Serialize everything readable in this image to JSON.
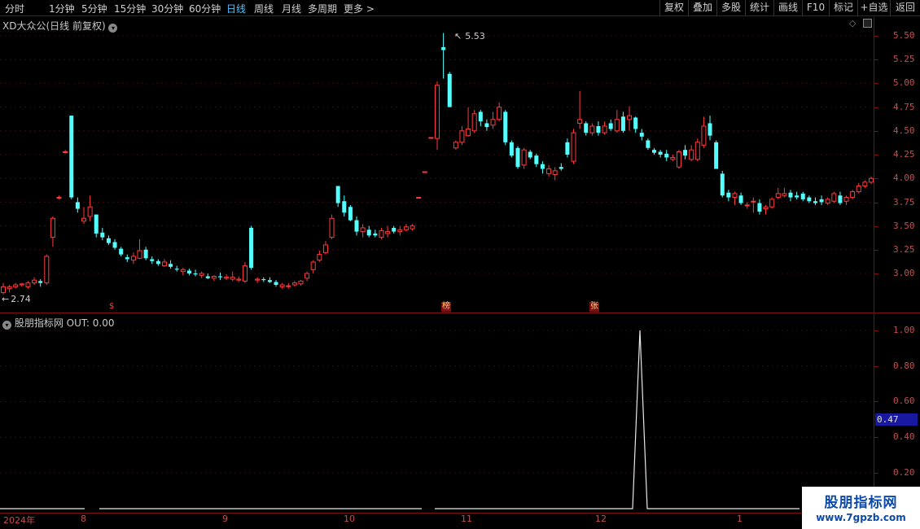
{
  "toolbar": {
    "periods": [
      "分时",
      "1分钟",
      "5分钟",
      "15分钟",
      "30分钟",
      "60分钟",
      "日线",
      "周线",
      "月线",
      "多周期",
      "更多 >"
    ],
    "active_period": "日线",
    "right_buttons": [
      "复权",
      "叠加",
      "多股",
      "统计",
      "画线",
      "F10",
      "标记",
      "+自选",
      "返回"
    ]
  },
  "main_panel": {
    "title": "XD大众公(日线 前复权)",
    "high_label": "5.53",
    "low_label": "2.74",
    "y_labels": [
      "5.50",
      "5.25",
      "5.00",
      "4.75",
      "4.50",
      "4.25",
      "4.00",
      "3.75",
      "3.50",
      "3.25",
      "3.00"
    ],
    "markers": [
      "$",
      "榜",
      "张"
    ]
  },
  "indicator_panel": {
    "title": "股朋指标网 OUT: 0.00",
    "y_labels": [
      "1.00",
      "0.80",
      "0.60",
      "0.40",
      "0.20"
    ],
    "current_value": "0.47"
  },
  "date_axis": [
    "2024年",
    "8",
    "9",
    "10",
    "11",
    "12",
    "1"
  ],
  "watermark": {
    "line1": "股朋指标网",
    "line2": "www.7gpzb.com"
  },
  "colors": {
    "up": "#ff3b3b",
    "down": "#54ffff",
    "axis": "#7a1010"
  },
  "chart_data": {
    "type": "candlestick",
    "ylim": [
      2.7,
      5.65
    ],
    "candles": [
      [
        2.8,
        2.9,
        2.78,
        2.86
      ],
      [
        2.84,
        2.88,
        2.8,
        2.86
      ],
      [
        2.86,
        2.9,
        2.84,
        2.88
      ],
      [
        2.88,
        2.9,
        2.86,
        2.89
      ],
      [
        2.86,
        2.92,
        2.84,
        2.9
      ],
      [
        2.9,
        2.96,
        2.88,
        2.93
      ],
      [
        2.92,
        2.94,
        2.86,
        2.9
      ],
      [
        2.9,
        3.2,
        2.88,
        3.18
      ],
      [
        3.38,
        3.6,
        3.28,
        3.58
      ],
      [
        3.8,
        3.82,
        3.78,
        3.8
      ],
      [
        4.28,
        4.3,
        4.26,
        4.28
      ],
      [
        4.66,
        4.66,
        3.78,
        3.8
      ],
      [
        3.75,
        3.8,
        3.64,
        3.68
      ],
      [
        3.55,
        3.7,
        3.52,
        3.58
      ],
      [
        3.6,
        3.82,
        3.55,
        3.7
      ],
      [
        3.62,
        3.62,
        3.38,
        3.42
      ],
      [
        3.43,
        3.48,
        3.35,
        3.38
      ],
      [
        3.37,
        3.4,
        3.3,
        3.32
      ],
      [
        3.33,
        3.36,
        3.25,
        3.27
      ],
      [
        3.26,
        3.28,
        3.18,
        3.2
      ],
      [
        3.17,
        3.2,
        3.12,
        3.15
      ],
      [
        3.14,
        3.22,
        3.1,
        3.18
      ],
      [
        3.16,
        3.36,
        3.15,
        3.24
      ],
      [
        3.25,
        3.28,
        3.14,
        3.16
      ],
      [
        3.15,
        3.18,
        3.1,
        3.13
      ],
      [
        3.13,
        3.15,
        3.08,
        3.1
      ],
      [
        3.08,
        3.15,
        3.07,
        3.12
      ],
      [
        3.1,
        3.14,
        3.05,
        3.07
      ],
      [
        3.05,
        3.08,
        3.02,
        3.04
      ],
      [
        3.02,
        3.06,
        2.98,
        3.04
      ],
      [
        3.03,
        3.05,
        2.98,
        3.0
      ],
      [
        3.0,
        3.04,
        2.97,
        2.99
      ],
      [
        2.98,
        3.02,
        2.95,
        3.0
      ],
      [
        2.97,
        3.0,
        2.94,
        2.95
      ],
      [
        2.95,
        2.98,
        2.92,
        2.97
      ],
      [
        2.97,
        3.01,
        2.93,
        2.96
      ],
      [
        2.95,
        2.99,
        2.93,
        2.96
      ],
      [
        2.94,
        3.02,
        2.92,
        2.96
      ],
      [
        2.93,
        2.97,
        2.91,
        2.94
      ],
      [
        2.92,
        3.12,
        2.9,
        3.08
      ],
      [
        3.48,
        3.5,
        3.04,
        3.06
      ],
      [
        2.93,
        2.96,
        2.9,
        2.94
      ],
      [
        2.94,
        2.96,
        2.91,
        2.93
      ],
      [
        2.93,
        2.96,
        2.9,
        2.91
      ],
      [
        2.91,
        2.93,
        2.86,
        2.88
      ],
      [
        2.86,
        2.9,
        2.84,
        2.88
      ],
      [
        2.87,
        2.9,
        2.84,
        2.87
      ],
      [
        2.88,
        2.92,
        2.86,
        2.9
      ],
      [
        2.89,
        2.93,
        2.87,
        2.92
      ],
      [
        2.95,
        3.02,
        2.92,
        3.0
      ],
      [
        3.04,
        3.14,
        3.0,
        3.12
      ],
      [
        3.14,
        3.24,
        3.12,
        3.2
      ],
      [
        3.22,
        3.34,
        3.2,
        3.3
      ],
      [
        3.38,
        3.62,
        3.36,
        3.58
      ],
      [
        3.92,
        3.92,
        3.7,
        3.74
      ],
      [
        3.76,
        3.82,
        3.6,
        3.64
      ],
      [
        3.7,
        3.72,
        3.55,
        3.56
      ],
      [
        3.56,
        3.6,
        3.4,
        3.44
      ],
      [
        3.44,
        3.52,
        3.38,
        3.48
      ],
      [
        3.46,
        3.5,
        3.38,
        3.4
      ],
      [
        3.42,
        3.46,
        3.38,
        3.4
      ],
      [
        3.38,
        3.48,
        3.36,
        3.45
      ],
      [
        3.42,
        3.5,
        3.38,
        3.44
      ],
      [
        3.48,
        3.5,
        3.42,
        3.44
      ],
      [
        3.44,
        3.5,
        3.4,
        3.46
      ],
      [
        3.46,
        3.52,
        3.44,
        3.49
      ],
      [
        3.47,
        3.52,
        3.45,
        3.5
      ],
      [
        3.8,
        3.8,
        3.8,
        3.8
      ],
      [
        4.07,
        4.07,
        4.07,
        4.07
      ],
      [
        4.43,
        4.43,
        4.43,
        4.43
      ],
      [
        4.42,
        5.02,
        4.3,
        4.98
      ],
      [
        5.38,
        5.53,
        5.05,
        5.35
      ],
      [
        5.1,
        5.12,
        4.75,
        4.75
      ],
      [
        4.32,
        4.4,
        4.3,
        4.38
      ],
      [
        4.38,
        4.55,
        4.35,
        4.5
      ],
      [
        4.45,
        4.75,
        4.44,
        4.52
      ],
      [
        4.5,
        4.72,
        4.48,
        4.68
      ],
      [
        4.7,
        4.72,
        4.55,
        4.6
      ],
      [
        4.58,
        4.62,
        4.5,
        4.54
      ],
      [
        4.56,
        4.7,
        4.52,
        4.62
      ],
      [
        4.62,
        4.8,
        4.6,
        4.75
      ],
      [
        4.7,
        4.72,
        4.35,
        4.38
      ],
      [
        4.38,
        4.4,
        4.22,
        4.24
      ],
      [
        4.32,
        4.34,
        4.1,
        4.12
      ],
      [
        4.14,
        4.32,
        4.1,
        4.3
      ],
      [
        4.28,
        4.3,
        4.2,
        4.22
      ],
      [
        4.24,
        4.26,
        4.12,
        4.15
      ],
      [
        4.15,
        4.18,
        4.05,
        4.1
      ],
      [
        4.05,
        4.14,
        4.02,
        4.1
      ],
      [
        4.04,
        4.12,
        3.98,
        4.08
      ],
      [
        4.12,
        4.16,
        4.08,
        4.1
      ],
      [
        4.38,
        4.42,
        4.22,
        4.25
      ],
      [
        4.18,
        4.52,
        4.15,
        4.48
      ],
      [
        4.58,
        4.92,
        4.52,
        4.62
      ],
      [
        4.58,
        4.6,
        4.45,
        4.48
      ],
      [
        4.48,
        4.58,
        4.45,
        4.55
      ],
      [
        4.55,
        4.6,
        4.45,
        4.48
      ],
      [
        4.48,
        4.6,
        4.46,
        4.55
      ],
      [
        4.58,
        4.62,
        4.5,
        4.52
      ],
      [
        4.5,
        4.72,
        4.48,
        4.62
      ],
      [
        4.65,
        4.7,
        4.48,
        4.5
      ],
      [
        4.62,
        4.76,
        4.5,
        4.66
      ],
      [
        4.64,
        4.65,
        4.48,
        4.52
      ],
      [
        4.48,
        4.52,
        4.4,
        4.44
      ],
      [
        4.4,
        4.42,
        4.3,
        4.32
      ],
      [
        4.3,
        4.32,
        4.25,
        4.27
      ],
      [
        4.28,
        4.3,
        4.22,
        4.25
      ],
      [
        4.26,
        4.3,
        4.18,
        4.22
      ],
      [
        4.2,
        4.25,
        4.18,
        4.22
      ],
      [
        4.12,
        4.3,
        4.1,
        4.28
      ],
      [
        4.3,
        4.35,
        4.2,
        4.24
      ],
      [
        4.2,
        4.35,
        4.18,
        4.3
      ],
      [
        4.2,
        4.42,
        4.18,
        4.38
      ],
      [
        4.35,
        4.65,
        4.32,
        4.55
      ],
      [
        4.58,
        4.66,
        4.4,
        4.45
      ],
      [
        4.38,
        4.4,
        4.1,
        4.1
      ],
      [
        4.05,
        4.08,
        3.8,
        3.82
      ],
      [
        3.85,
        3.88,
        3.76,
        3.8
      ],
      [
        3.8,
        3.86,
        3.72,
        3.84
      ],
      [
        3.82,
        3.85,
        3.72,
        3.74
      ],
      [
        3.72,
        3.75,
        3.68,
        3.72
      ],
      [
        3.76,
        3.8,
        3.64,
        3.76
      ],
      [
        3.74,
        3.78,
        3.62,
        3.65
      ],
      [
        3.68,
        3.72,
        3.62,
        3.7
      ],
      [
        3.7,
        3.8,
        3.68,
        3.78
      ],
      [
        3.8,
        3.9,
        3.78,
        3.84
      ],
      [
        3.82,
        3.9,
        3.8,
        3.84
      ],
      [
        3.85,
        3.88,
        3.76,
        3.8
      ],
      [
        3.82,
        3.86,
        3.78,
        3.8
      ],
      [
        3.84,
        3.86,
        3.76,
        3.78
      ],
      [
        3.8,
        3.82,
        3.74,
        3.76
      ],
      [
        3.76,
        3.8,
        3.72,
        3.74
      ],
      [
        3.78,
        3.82,
        3.72,
        3.75
      ],
      [
        3.74,
        3.8,
        3.72,
        3.78
      ],
      [
        3.76,
        3.86,
        3.74,
        3.84
      ],
      [
        3.82,
        3.86,
        3.72,
        3.74
      ],
      [
        3.76,
        3.82,
        3.72,
        3.8
      ],
      [
        3.8,
        3.88,
        3.78,
        3.86
      ],
      [
        3.86,
        3.95,
        3.84,
        3.92
      ],
      [
        3.92,
        3.98,
        3.9,
        3.96
      ],
      [
        3.96,
        4.02,
        3.94,
        4.0
      ]
    ],
    "out_series_spike": {
      "value": 1.0
    },
    "out_ylim": [
      0,
      1.05
    ]
  }
}
